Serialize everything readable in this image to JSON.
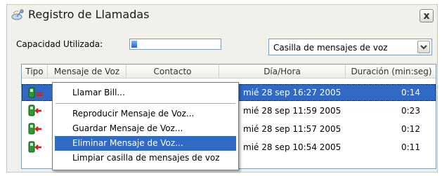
{
  "window": {
    "title": "Registro de Llamadas",
    "close_label": "x"
  },
  "capacity": {
    "label": "Capacidad Utilizada:",
    "used_fraction": 0.06
  },
  "mailbox_select": {
    "value": "Casilla de mensajes de voz"
  },
  "table": {
    "columns": [
      "Tipo",
      "Mensaje de Voz",
      "Contacto",
      "Día/Hora",
      "Duración (min:seg)"
    ],
    "rows": [
      {
        "datetime": "mié 28 sep 16:27 2005",
        "duration": "0:14",
        "selected": true,
        "icon": "voicemail-phone-icon"
      },
      {
        "datetime": "mié 28 sep 11:59 2005",
        "duration": "0:23",
        "selected": false,
        "icon": "incoming-call-icon"
      },
      {
        "datetime": "mié 28 sep 11:57 2005",
        "duration": "0:12",
        "selected": false,
        "icon": "incoming-call-icon"
      },
      {
        "datetime": "mié 28 sep 10:54 2005",
        "duration": "0:11",
        "selected": false,
        "icon": "incoming-call-icon"
      }
    ]
  },
  "context_menu": {
    "items": [
      "Llamar Bill...",
      "Reproducir Mensaje de Voz...",
      "Guardar Mensaje de Voz...",
      "Eliminar Mensaje de Voz...",
      "Limpiar casilla de mensajes de voz"
    ],
    "highlighted_index": 3
  },
  "colors": {
    "selection": "#316ac5",
    "window_bg": "#f1f0ea",
    "phone_green": "#2e9a2e",
    "arrow_red": "#d81e1e"
  }
}
